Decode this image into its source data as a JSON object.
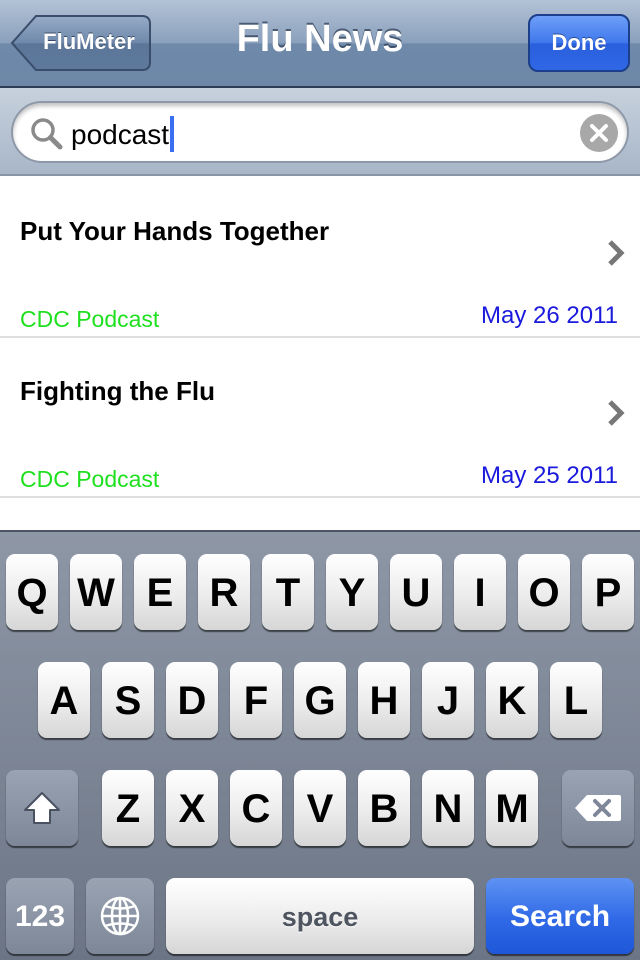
{
  "navbar": {
    "back_label": "FluMeter",
    "title": "Flu News",
    "done_label": "Done"
  },
  "search": {
    "value": "podcast",
    "icon": "magnifier-icon",
    "clear_icon": "clear-x-icon"
  },
  "news": [
    {
      "title": "Put Your Hands Together",
      "source": "CDC Podcast",
      "date": "May 26 2011"
    },
    {
      "title": "Fighting the Flu",
      "source": "CDC Podcast",
      "date": "May 25 2011"
    }
  ],
  "keyboard": {
    "row1": [
      "Q",
      "W",
      "E",
      "R",
      "T",
      "Y",
      "U",
      "I",
      "O",
      "P"
    ],
    "row2": [
      "A",
      "S",
      "D",
      "F",
      "G",
      "H",
      "J",
      "K",
      "L"
    ],
    "row3": [
      "Z",
      "X",
      "C",
      "V",
      "B",
      "N",
      "M"
    ],
    "numbers_label": "123",
    "space_label": "space",
    "search_label": "Search",
    "shift_icon": "shift-arrow-icon",
    "delete_icon": "backspace-icon",
    "globe_icon": "globe-icon"
  },
  "colors": {
    "source_text": "#1fe01f",
    "date_text": "#1a1adc",
    "accent_blue": "#2f67e6"
  }
}
